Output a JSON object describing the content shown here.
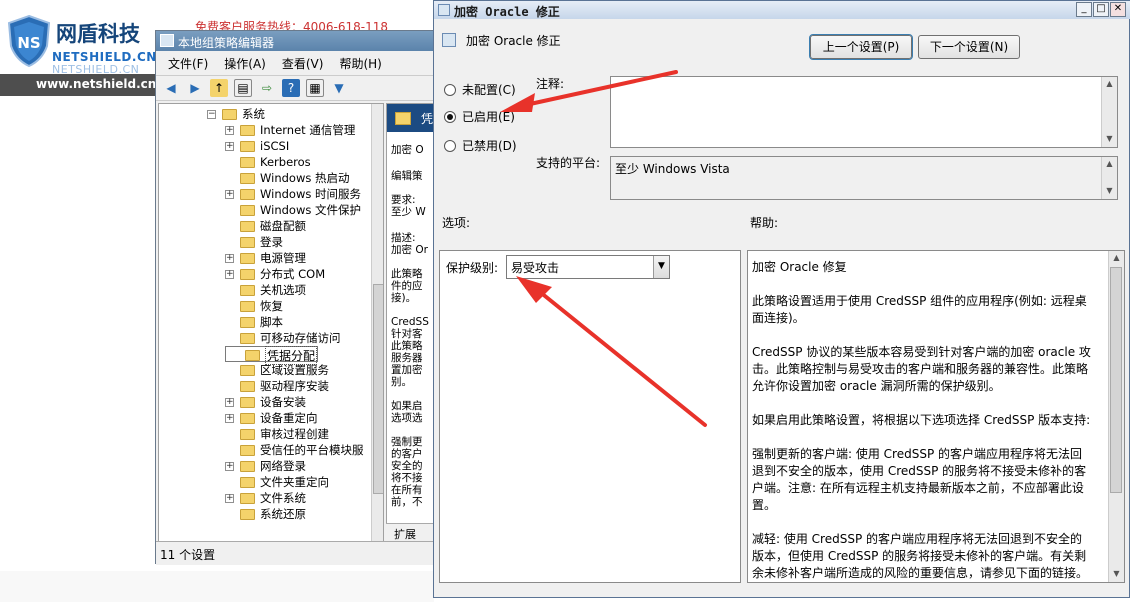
{
  "logo": {
    "cn": "网盾科技",
    "en": "NETSHIELD.CN",
    "en2": "NETSHIELD.CN",
    "badge": "NS",
    "url": "www.netshield.cn"
  },
  "background": {
    "top_text": "免费客户服务热线：4006-618-118"
  },
  "gpedit": {
    "title": "本地组策略编辑器",
    "menu": [
      "文件(F)",
      "操作(A)",
      "查看(V)",
      "帮助(H)"
    ],
    "tree": [
      {
        "label": "系统",
        "level": 0,
        "exp": "minus"
      },
      {
        "label": "Internet 通信管理",
        "level": 1,
        "exp": "plus"
      },
      {
        "label": "iSCSI",
        "level": 1,
        "exp": "plus"
      },
      {
        "label": "Kerberos",
        "level": 1,
        "exp": "none"
      },
      {
        "label": "Windows 热启动",
        "level": 1,
        "exp": "none"
      },
      {
        "label": "Windows 时间服务",
        "level": 1,
        "exp": "plus"
      },
      {
        "label": "Windows 文件保护",
        "level": 1,
        "exp": "none"
      },
      {
        "label": "磁盘配额",
        "level": 1,
        "exp": "none"
      },
      {
        "label": "登录",
        "level": 1,
        "exp": "none"
      },
      {
        "label": "电源管理",
        "level": 1,
        "exp": "plus"
      },
      {
        "label": "分布式 COM",
        "level": 1,
        "exp": "plus"
      },
      {
        "label": "关机选项",
        "level": 1,
        "exp": "none"
      },
      {
        "label": "恢复",
        "level": 1,
        "exp": "none"
      },
      {
        "label": "脚本",
        "level": 1,
        "exp": "none"
      },
      {
        "label": "可移动存储访问",
        "level": 1,
        "exp": "none"
      },
      {
        "label": "凭据分配",
        "level": 1,
        "exp": "none",
        "selected": true
      },
      {
        "label": "区域设置服务",
        "level": 1,
        "exp": "none"
      },
      {
        "label": "驱动程序安装",
        "level": 1,
        "exp": "none"
      },
      {
        "label": "设备安装",
        "level": 1,
        "exp": "plus"
      },
      {
        "label": "设备重定向",
        "level": 1,
        "exp": "plus"
      },
      {
        "label": "审核过程创建",
        "level": 1,
        "exp": "none"
      },
      {
        "label": "受信任的平台模块服",
        "level": 1,
        "exp": "none"
      },
      {
        "label": "网络登录",
        "level": 1,
        "exp": "plus"
      },
      {
        "label": "文件夹重定向",
        "level": 1,
        "exp": "none"
      },
      {
        "label": "文件系统",
        "level": 1,
        "exp": "plus"
      },
      {
        "label": "系统还原",
        "level": 1,
        "exp": "none"
      }
    ],
    "desc_header": "凭",
    "desc_lines": [
      "加密 O",
      "编辑策",
      "要求:",
      "至少 W",
      "描述:",
      "加密 Or",
      "此策略",
      "件的应",
      "接)。",
      "CredSS",
      "针对客",
      "此策略",
      "服务器",
      "置加密",
      "别。",
      "如果启",
      "选项选",
      "强制更",
      "的客户",
      "安全的",
      "将不接",
      "在所有",
      "前，不"
    ],
    "tab": "扩展",
    "status": "11 个设置"
  },
  "dialog": {
    "title": "加密 Oracle 修正",
    "header_label": "加密 Oracle 修正",
    "prev_button": "上一个设置(P)",
    "next_button": "下一个设置(N)",
    "radio_not_configured": "未配置(C)",
    "radio_enabled": "已启用(E)",
    "radio_disabled": "已禁用(D)",
    "comment_label": "注释:",
    "comment_value": "",
    "platform_label": "支持的平台:",
    "platform_value": "至少 Windows Vista",
    "options_label": "选项:",
    "help_label": "帮助:",
    "protection_label": "保护级别:",
    "protection_value": "易受攻击",
    "help_paragraphs": [
      "加密 Oracle 修复",
      "此策略设置适用于使用 CredSSP 组件的应用程序(例如: 远程桌面连接)。",
      "CredSSP 协议的某些版本容易受到针对客户端的加密 oracle 攻击。此策略控制与易受攻击的客户端和服务器的兼容性。此策略允许你设置加密 oracle 漏洞所需的保护级别。",
      "如果启用此策略设置，将根据以下选项选择 CredSSP 版本支持:",
      "强制更新的客户端: 使用 CredSSP 的客户端应用程序将无法回退到不安全的版本，使用 CredSSP 的服务将不接受未修补的客户端。注意: 在所有远程主机支持最新版本之前，不应部署此设置。",
      "减轻: 使用 CredSSP 的客户端应用程序将无法回退到不安全的版本，但使用 CredSSP 的服务将接受未修补的客户端。有关剩余未修补客户端所造成的风险的重要信息，请参见下面的链接。"
    ]
  },
  "colors": {
    "annotation_arrow": "#e8322a",
    "title_blue": "#1c4b82"
  }
}
